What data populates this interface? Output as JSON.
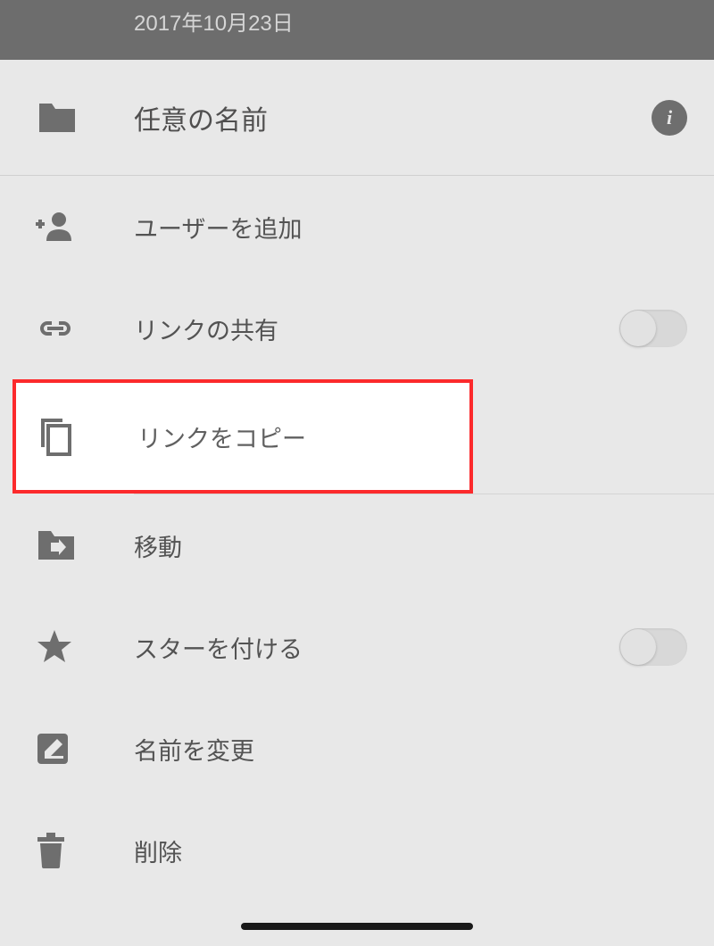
{
  "topBar": {
    "date": "2017年10月23日"
  },
  "header": {
    "title": "任意の名前"
  },
  "menu": {
    "addUser": "ユーザーを追加",
    "linkShare": "リンクの共有",
    "copyLink": "リンクをコピー",
    "move": "移動",
    "addStar": "スターを付ける",
    "rename": "名前を変更",
    "delete": "削除"
  },
  "toggles": {
    "linkShare": false,
    "addStar": false
  }
}
